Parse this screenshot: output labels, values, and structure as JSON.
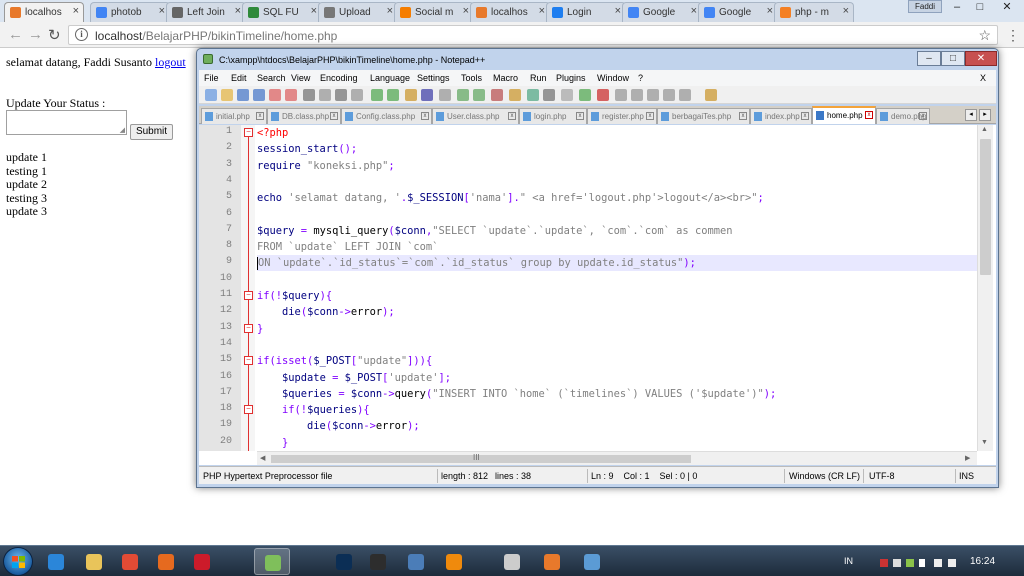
{
  "browser": {
    "tabs": [
      {
        "label": "localhos",
        "icon": "xampp-icon",
        "color": "#e8792b",
        "active": true
      },
      {
        "label": "photob",
        "icon": "google-icon",
        "color": "#4285f4"
      },
      {
        "label": "Left Join",
        "icon": "page-icon",
        "color": "#666666"
      },
      {
        "label": "SQL FU",
        "icon": "sql-icon",
        "color": "#2f8a3b"
      },
      {
        "label": "Upload",
        "icon": "page-icon",
        "color": "#777777"
      },
      {
        "label": "Social m",
        "icon": "blogger-icon",
        "color": "#f57d00"
      },
      {
        "label": "localhos",
        "icon": "xampp-icon",
        "color": "#e8792b"
      },
      {
        "label": "Login",
        "icon": "dropbox-icon",
        "color": "#1e7ef0"
      },
      {
        "label": "Google",
        "icon": "google-icon",
        "color": "#4285f4"
      },
      {
        "label": "Google",
        "icon": "google-icon",
        "color": "#4285f4"
      },
      {
        "label": "php - m",
        "icon": "stackoverflow-icon",
        "color": "#f48024"
      }
    ],
    "user_label": "Faddi",
    "window_buttons": {
      "minimize": "–",
      "maximize": "□",
      "close": "✕"
    },
    "url_host": "localhost",
    "url_path": "/BelajarPHP/bikinTimeline/home.php",
    "nav": {
      "back": "←",
      "forward": "→",
      "reload": "↻"
    },
    "star": "☆",
    "menu": "⋮"
  },
  "page": {
    "welcome_text": "selamat datang, Faddi Susanto",
    "logout_link": "logout",
    "status_label": "Update Your Status :",
    "status_value": "",
    "submit_label": "Submit",
    "updates": [
      "update 1",
      "testing 1",
      "update 2",
      "testing 3",
      "update 3"
    ]
  },
  "npp": {
    "title": "C:\\xampp\\htdocs\\BelajarPHP\\bikinTimeline\\home.php - Notepad++",
    "title_buttons": {
      "minimize": "–",
      "maximize": "□",
      "close": "✕"
    },
    "menu": [
      "File",
      "Edit",
      "Search",
      "View",
      "Encoding",
      "Language",
      "Settings",
      "Tools",
      "Macro",
      "Run",
      "Plugins",
      "Window",
      "?"
    ],
    "menu_close": "X",
    "file_tabs": [
      {
        "label": "initial.php",
        "active": false
      },
      {
        "label": "DB.class.php",
        "active": false
      },
      {
        "label": "Config.class.php",
        "active": false
      },
      {
        "label": "User.class.php",
        "active": false
      },
      {
        "label": "login.php",
        "active": false
      },
      {
        "label": "register.php",
        "active": false
      },
      {
        "label": "berbagaiTes.php",
        "active": false
      },
      {
        "label": "index.php",
        "active": false
      },
      {
        "label": "home.php",
        "active": true
      },
      {
        "label": "demo.php",
        "active": false
      }
    ],
    "tab_close": "x",
    "tab_nav": {
      "left": "◂",
      "right": "▸"
    },
    "line_numbers": [
      "1",
      "2",
      "3",
      "4",
      "5",
      "6",
      "7",
      "8",
      "9",
      "10",
      "11",
      "12",
      "13",
      "14",
      "15",
      "16",
      "17",
      "18",
      "19",
      "20"
    ],
    "fold_markers": {
      "open": "−",
      "close": "−"
    },
    "code_lines": [
      [
        [
          "php",
          "<?php"
        ]
      ],
      [
        [
          "var",
          "session_start"
        ],
        [
          "op",
          "();"
        ]
      ],
      [
        [
          "var",
          "require "
        ],
        [
          "str",
          "\"koneksi.php\""
        ],
        [
          "op",
          ";"
        ]
      ],
      [],
      [
        [
          "var",
          "echo "
        ],
        [
          "str",
          "'selamat datang, '"
        ],
        [
          "op",
          "."
        ],
        [
          "var",
          "$_SESSION"
        ],
        [
          "op",
          "["
        ],
        [
          "str",
          "'nama'"
        ],
        [
          "op",
          "]."
        ],
        [
          "str",
          "\" <a href='logout.php'>logout</a><br>\""
        ],
        [
          "op",
          ";"
        ]
      ],
      [],
      [
        [
          "var",
          "$query "
        ],
        [
          "op",
          "= "
        ],
        [
          "plain",
          "mysqli_query"
        ],
        [
          "op",
          "("
        ],
        [
          "var",
          "$conn"
        ],
        [
          "op",
          ","
        ],
        [
          "str",
          "\"SELECT `update`.`update`, `com`.`com` as commen"
        ]
      ],
      [
        [
          "str",
          "FROM `update` LEFT JOIN `com`"
        ]
      ],
      [
        [
          "str",
          "ON `update`.`id_status`=`com`.`id_status` group by update.id_status\""
        ],
        [
          "op",
          ");"
        ]
      ],
      [],
      [
        [
          "op",
          "if(!"
        ],
        [
          "var",
          "$query"
        ],
        [
          "op",
          ")"
        ],
        [
          "op",
          "{"
        ]
      ],
      [
        [
          "plain",
          "    "
        ],
        [
          "var",
          "die"
        ],
        [
          "op",
          "("
        ],
        [
          "var",
          "$conn"
        ],
        [
          "op",
          "->"
        ],
        [
          "plain",
          "error"
        ],
        [
          "op",
          ");"
        ]
      ],
      [
        [
          "op",
          "}"
        ]
      ],
      [],
      [
        [
          "op",
          "if(isset("
        ],
        [
          "var",
          "$_POST"
        ],
        [
          "op",
          "["
        ],
        [
          "str",
          "\"update\""
        ],
        [
          "op",
          "])){"
        ]
      ],
      [
        [
          "plain",
          "    "
        ],
        [
          "var",
          "$update "
        ],
        [
          "op",
          "= "
        ],
        [
          "var",
          "$_POST"
        ],
        [
          "op",
          "["
        ],
        [
          "str",
          "'update'"
        ],
        [
          "op",
          "];"
        ]
      ],
      [
        [
          "plain",
          "    "
        ],
        [
          "var",
          "$queries "
        ],
        [
          "op",
          "= "
        ],
        [
          "var",
          "$conn"
        ],
        [
          "op",
          "->"
        ],
        [
          "plain",
          "query"
        ],
        [
          "op",
          "("
        ],
        [
          "str",
          "\"INSERT INTO `home` (`timelines`) VALUES ('$update')\""
        ],
        [
          "op",
          ");"
        ]
      ],
      [
        [
          "plain",
          "    "
        ],
        [
          "op",
          "if(!"
        ],
        [
          "var",
          "$queries"
        ],
        [
          "op",
          ")"
        ],
        [
          "op",
          "{"
        ]
      ],
      [
        [
          "plain",
          "        "
        ],
        [
          "var",
          "die"
        ],
        [
          "op",
          "("
        ],
        [
          "var",
          "$conn"
        ],
        [
          "op",
          "->"
        ],
        [
          "plain",
          "error"
        ],
        [
          "op",
          ");"
        ]
      ],
      [
        [
          "plain",
          "    "
        ],
        [
          "op",
          "}"
        ]
      ]
    ],
    "hscroll_mark": "III",
    "status": {
      "language": "PHP Hypertext Preprocessor file",
      "length": "length : 812",
      "lines": "lines : 38",
      "position": "Ln : 9    Col : 1    Sel : 0 | 0",
      "eol": "Windows (CR LF)",
      "encoding": "UTF-8",
      "mode": "INS"
    }
  },
  "taskbar": {
    "apps": [
      {
        "name": "ie-icon",
        "color": "#2b86d9"
      },
      {
        "name": "folder-icon",
        "color": "#e9c45a"
      },
      {
        "name": "chrome-icon",
        "color": "#e24b35"
      },
      {
        "name": "firefox-icon",
        "color": "#e66a1f"
      },
      {
        "name": "opera-icon",
        "color": "#cc1b2a"
      },
      {
        "name": "notepadpp-icon",
        "color": "#7fbf5b",
        "active": true
      },
      {
        "name": "photoshop-icon",
        "color": "#0b2e55"
      },
      {
        "name": "winamp-icon",
        "color": "#2d2d2d"
      },
      {
        "name": "explorer-icon",
        "color": "#4b7db8"
      },
      {
        "name": "vlc-icon",
        "color": "#f08a0c"
      },
      {
        "name": "media-icon",
        "color": "#cccccc"
      },
      {
        "name": "xampp-icon",
        "color": "#e8792b"
      },
      {
        "name": "app-icon",
        "color": "#5b9bd5"
      }
    ],
    "language": "IN",
    "time": "16:24"
  }
}
